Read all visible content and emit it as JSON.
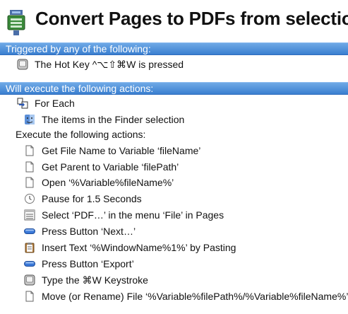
{
  "header": {
    "title": "Convert Pages to PDFs from selection",
    "icon": "macro-icon"
  },
  "triggers": {
    "section_label": "Triggered by any of the following:",
    "items": [
      {
        "label": "The Hot Key ^⌥⇧⌘W is pressed",
        "icon": "keyboard-icon"
      }
    ]
  },
  "actions": {
    "section_label": "Will execute the following actions:",
    "for_each": {
      "label": "For Each",
      "icon": "for-each-icon",
      "collection": {
        "label": "The items in the Finder selection",
        "icon": "finder-icon"
      },
      "execute_label": "Execute the following actions:",
      "steps": [
        {
          "label": "Get File Name to Variable ‘fileName’",
          "icon": "document-icon"
        },
        {
          "label": "Get Parent to Variable ‘filePath’",
          "icon": "document-icon"
        },
        {
          "label": "Open ‘%Variable%fileName%’",
          "icon": "document-icon"
        },
        {
          "label": "Pause for 1.5 Seconds",
          "icon": "clock-icon"
        },
        {
          "label": "Select ‘PDF…’ in the menu ‘File’ in Pages",
          "icon": "menu-icon"
        },
        {
          "label": "Press Button ‘Next…’",
          "icon": "button-icon"
        },
        {
          "label": "Insert Text ‘%WindowName%1%’ by Pasting",
          "icon": "clipboard-icon"
        },
        {
          "label": "Press Button ‘Export’",
          "icon": "button-icon"
        },
        {
          "label": "Type the ⌘W Keystroke",
          "icon": "keyboard-icon"
        },
        {
          "label": "Move (or Rename) File ‘%Variable%filePath%/%Variable%fileName%’",
          "icon": "document-icon"
        }
      ]
    }
  },
  "colors": {
    "section_bar_top": "#6fa9e6",
    "section_bar_bottom": "#3a7fd0",
    "button_icon_blue": "#3a78d8"
  }
}
